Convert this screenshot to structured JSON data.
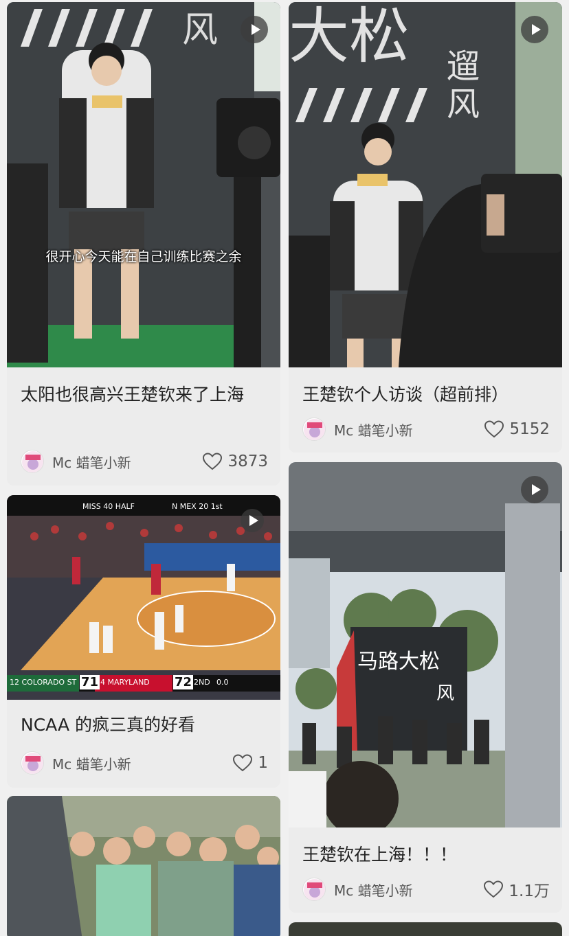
{
  "posts": [
    {
      "title": "太阳也很高兴王楚钦来了上海",
      "subtitle": "很开心今天能在自己训练比赛之余",
      "author": "Mc 蜡笔小新",
      "likes": "3873",
      "has_video": true
    },
    {
      "title": "王楚钦个人访谈（超前排）",
      "author": "Mc 蜡笔小新",
      "likes": "5152",
      "has_video": true
    },
    {
      "title": "NCAA 的疯三真的好看",
      "author": "Mc 蜡笔小新",
      "likes": "1",
      "has_video": true,
      "scoreboard": {
        "team1": "12 COLORADO ST",
        "score1": "71",
        "team2": "4  MARYLAND",
        "score2": "72",
        "period": "2ND",
        "clock": "0.0"
      }
    },
    {
      "title": "王楚钦在上海！！！",
      "author": "Mc 蜡笔小新",
      "likes": "1.1万",
      "has_video": true
    }
  ],
  "colors": {
    "card_bg": "#ececec",
    "text": "#222222",
    "meta": "#555555"
  },
  "icons": [
    "play-icon",
    "heart-icon",
    "avatar-icon"
  ]
}
